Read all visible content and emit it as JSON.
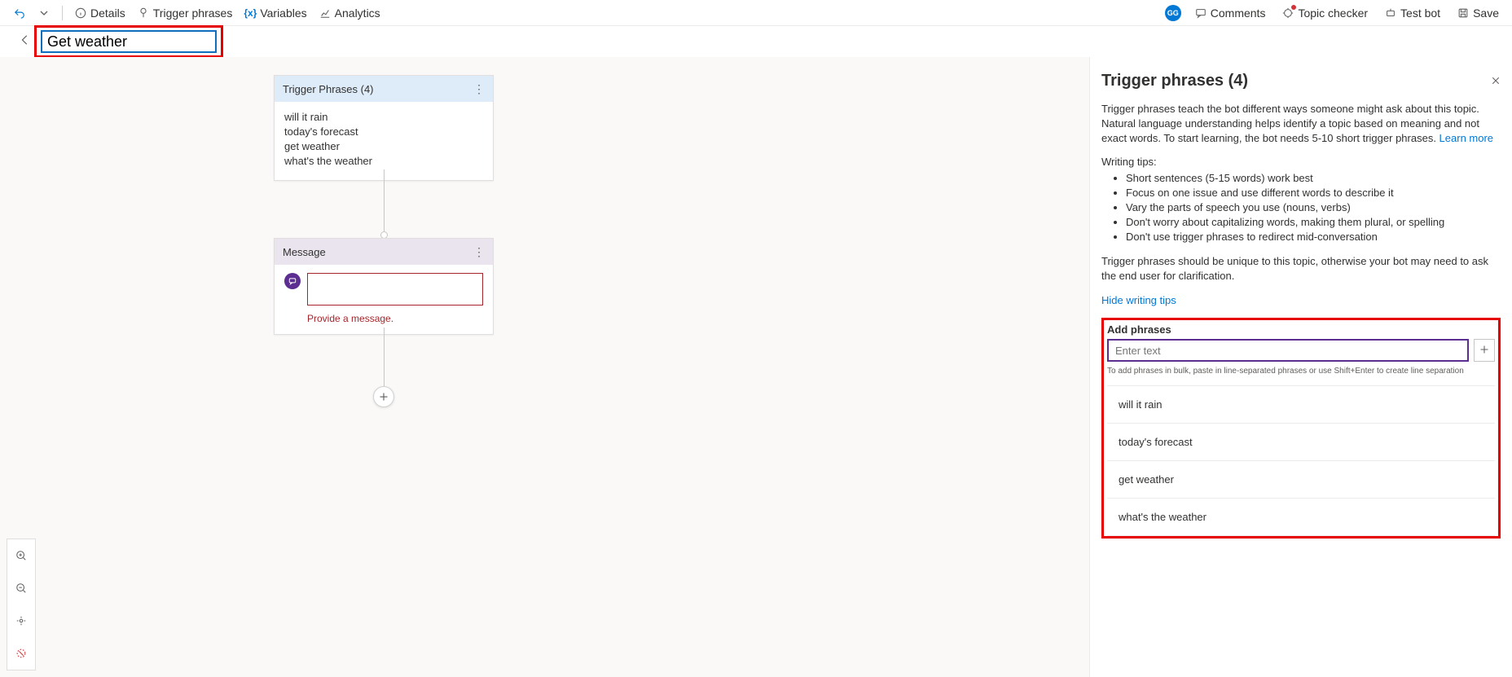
{
  "toolbar": {
    "details": "Details",
    "trigger_phrases": "Trigger phrases",
    "variables": "Variables",
    "analytics": "Analytics",
    "avatar": "GG",
    "comments": "Comments",
    "topic_checker": "Topic checker",
    "test_bot": "Test bot",
    "save": "Save"
  },
  "topic_name": "Get weather",
  "trigger_node": {
    "title": "Trigger Phrases (4)",
    "phrases": [
      "will it rain",
      "today's forecast",
      "get weather",
      "what's the weather"
    ]
  },
  "message_node": {
    "title": "Message",
    "error": "Provide a message."
  },
  "panel": {
    "title": "Trigger phrases (4)",
    "desc_pre": "Trigger phrases teach the bot different ways someone might ask about this topic. Natural language understanding helps identify a topic based on meaning and not exact words. To start learning, the bot needs 5-10 short trigger phrases. ",
    "learn_more": "Learn more",
    "tips_label": "Writing tips:",
    "tips": [
      "Short sentences (5-15 words) work best",
      "Focus on one issue and use different words to describe it",
      "Vary the parts of speech you use (nouns, verbs)",
      "Don't worry about capitalizing words, making them plural, or spelling",
      "Don't use trigger phrases to redirect mid-conversation"
    ],
    "footnote": "Trigger phrases should be unique to this topic, otherwise your bot may need to ask the end user for clarification.",
    "hide_tips": "Hide writing tips",
    "add_label": "Add phrases",
    "add_placeholder": "Enter text",
    "add_hint": "To add phrases in bulk, paste in line-separated phrases or use Shift+Enter to create line separation",
    "phrases": [
      "will it rain",
      "today's forecast",
      "get weather",
      "what's the weather"
    ]
  }
}
